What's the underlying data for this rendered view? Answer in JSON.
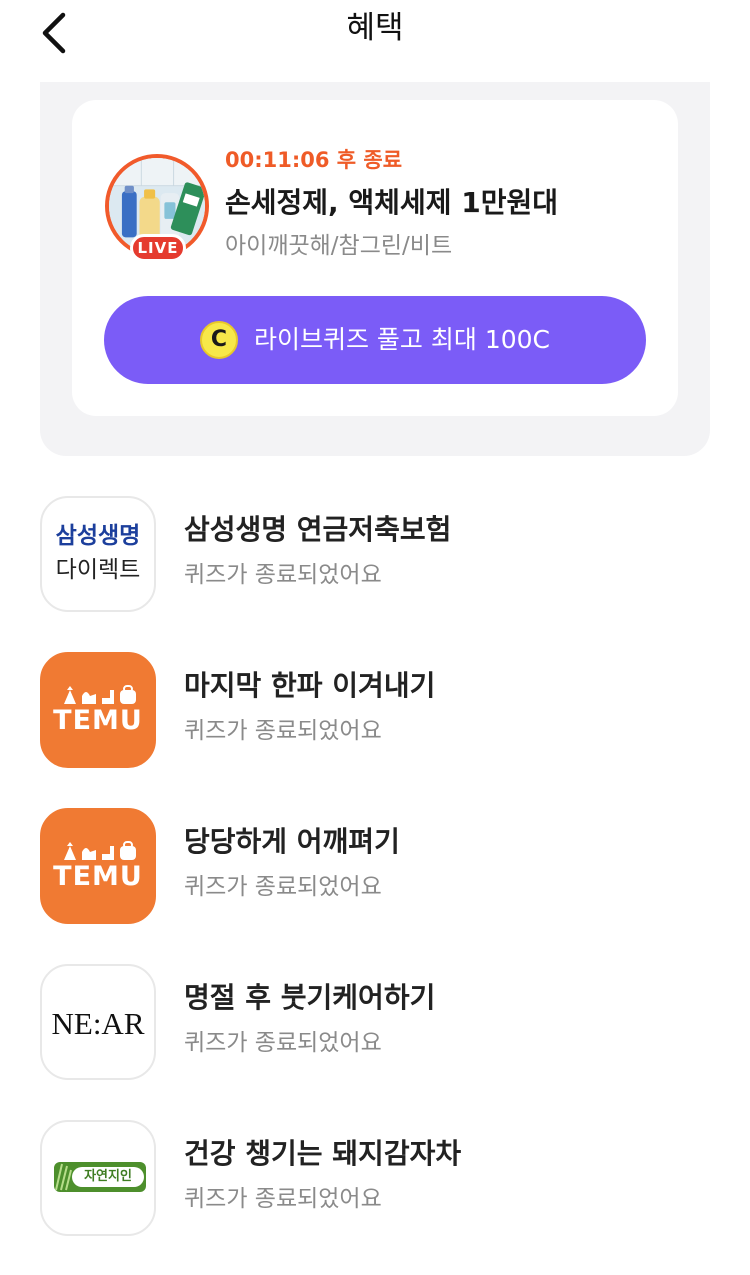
{
  "header": {
    "title": "혜택",
    "back_icon": "chevron-left-icon"
  },
  "live": {
    "badge": "LIVE",
    "timer": "00:11:06 후 종료",
    "title": "손세정제, 액체세제 1만원대",
    "brands": "아이깨끗해/참그린/비트",
    "coin_label": "C",
    "quiz_button": "라이브퀴즈 풀고 최대 100C",
    "colors": {
      "accent": "#7b5cf7",
      "timer": "#ef5b27",
      "live_badge": "#e53b2f"
    }
  },
  "quizzes": [
    {
      "logo": {
        "line1": "삼성생명",
        "line2": "다이렉트"
      },
      "title": "삼성생명 연금저축보험",
      "status": "퀴즈가 종료되었어요"
    },
    {
      "logo": {
        "text": "TEMU"
      },
      "title": "마지막 한파 이겨내기",
      "status": "퀴즈가 종료되었어요"
    },
    {
      "logo": {
        "text": "TEMU"
      },
      "title": "당당하게 어깨펴기",
      "status": "퀴즈가 종료되었어요"
    },
    {
      "logo": {
        "text": "NE:AR"
      },
      "title": "명절 후 붓기케어하기",
      "status": "퀴즈가 종료되었어요"
    },
    {
      "logo": {
        "text": "자연지인"
      },
      "title": "건강 챙기는 돼지감자차",
      "status": "퀴즈가 종료되었어요"
    }
  ]
}
